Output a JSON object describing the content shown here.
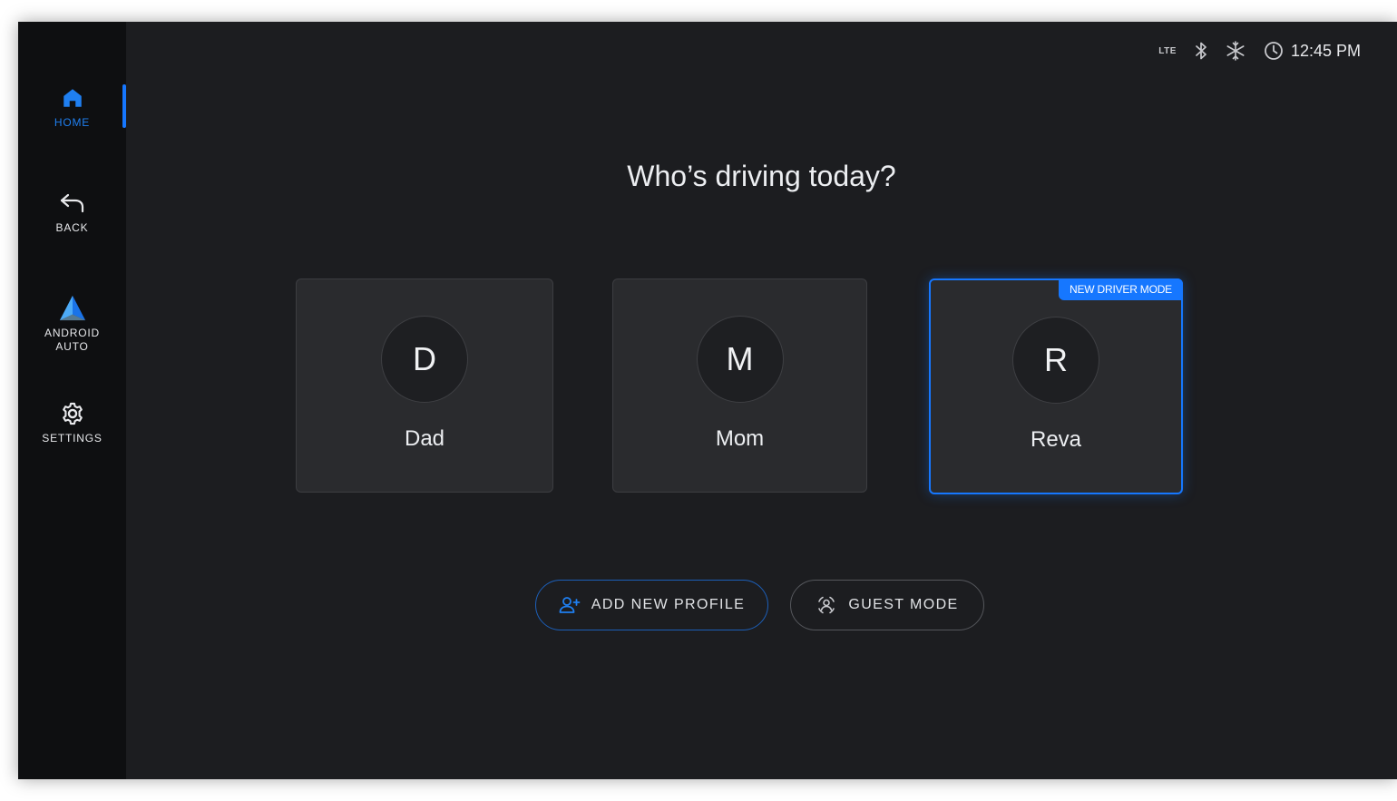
{
  "sidebar": {
    "items": [
      {
        "label": "HOME",
        "icon": "home-icon",
        "active": true
      },
      {
        "label": "BACK",
        "icon": "back-arrow-icon",
        "active": false
      },
      {
        "label": "ANDROID\nAUTO",
        "icon": "android-auto-icon",
        "active": false
      },
      {
        "label": "SETTINGS",
        "icon": "gear-icon",
        "active": false
      }
    ]
  },
  "status": {
    "network": "LTE",
    "bluetooth_icon": "bluetooth-icon",
    "climate_icon": "snowflake-icon",
    "clock_icon": "clock-icon",
    "time": "12:45 PM"
  },
  "main": {
    "title": "Who’s driving today?",
    "profiles": [
      {
        "initial": "D",
        "name": "Dad",
        "selected": false,
        "badge": ""
      },
      {
        "initial": "M",
        "name": "Mom",
        "selected": false,
        "badge": ""
      },
      {
        "initial": "R",
        "name": "Reva",
        "selected": true,
        "badge": "NEW DRIVER MODE"
      }
    ],
    "actions": {
      "add_profile_label": "ADD NEW PROFILE",
      "guest_mode_label": "GUEST MODE"
    }
  },
  "colors": {
    "accent": "#1677ff",
    "background": "#1c1d20",
    "sidebar": "#0e0f11",
    "card": "#2a2b2e"
  }
}
